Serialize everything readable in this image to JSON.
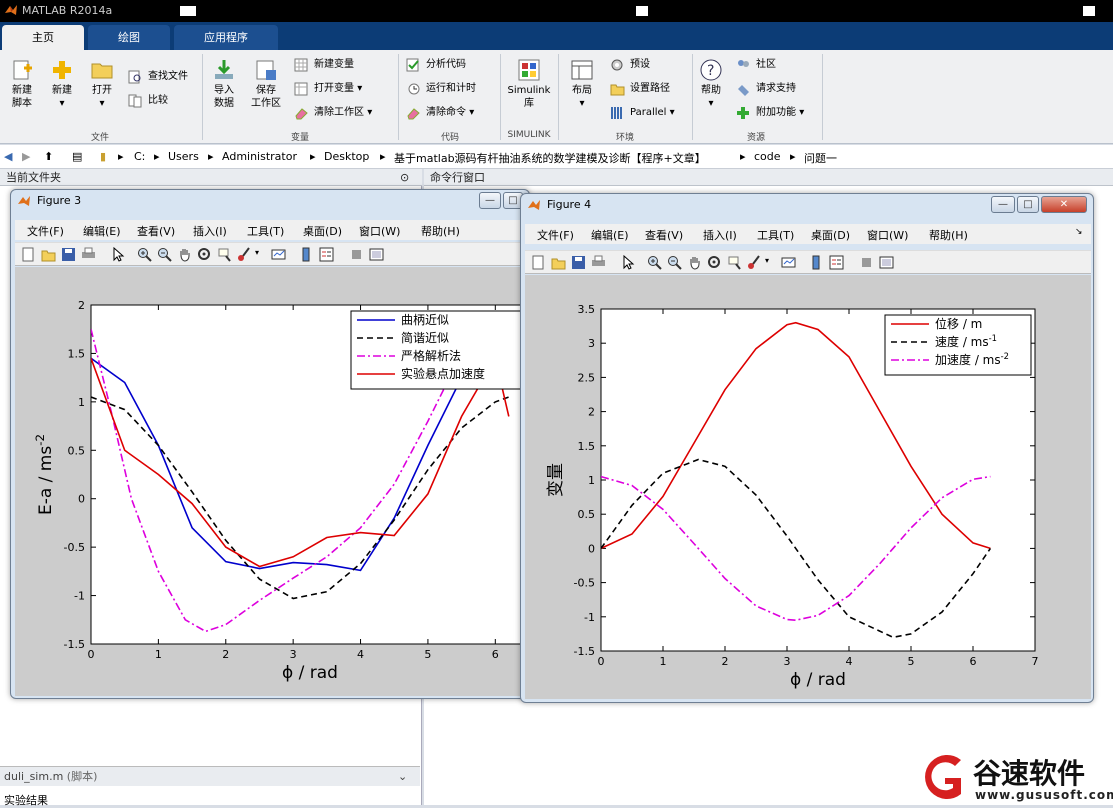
{
  "app": {
    "title": "MATLAB R2014a"
  },
  "tabs": [
    {
      "label": "主页"
    },
    {
      "label": "绘图"
    },
    {
      "label": "应用程序"
    }
  ],
  "ribbon": {
    "new_script": "新建\n脚本",
    "new": "新建",
    "open": "打开",
    "find_files": "查找文件",
    "compare": "比较",
    "import_data": "导入\n数据",
    "save_workspace": "保存\n工作区",
    "new_variable": "新建变量",
    "open_variable": "打开变量",
    "clear_workspace": "清除工作区",
    "analyze_code": "分析代码",
    "run_and_time": "运行和计时",
    "clear_commands": "清除命令",
    "simulink": "Simulink\n库",
    "layout": "布局",
    "preferences": "预设",
    "set_path": "设置路径",
    "parallel": "Parallel",
    "help": "帮助",
    "community": "社区",
    "request_support": "请求支持",
    "add_ons": "附加功能",
    "groups": {
      "file": "文件",
      "variable": "变量",
      "code": "代码",
      "simulink": "SIMULINK",
      "environment": "环境",
      "resources": "资源"
    }
  },
  "address": {
    "parts": [
      "C:",
      "Users",
      "Administrator",
      "Desktop",
      "基于matlab源码有杆抽油系统的数学建模及诊断【程序+文章】",
      "code",
      "问题一"
    ]
  },
  "panels": {
    "current_folder": "当前文件夹",
    "command_window": "命令行窗口",
    "script_file": "duli_sim.m",
    "script_type": "(脚本)",
    "bottom_text": "实验结果"
  },
  "figure3": {
    "title": "Figure 3",
    "menu": [
      "文件(F)",
      "编辑(E)",
      "查看(V)",
      "插入(I)",
      "工具(T)",
      "桌面(D)",
      "窗口(W)",
      "帮助(H)"
    ],
    "chart_data": {
      "type": "line",
      "xlabel": "ϕ / rad",
      "ylabel": "E-a / ms-2",
      "xlim": [
        0,
        6.5
      ],
      "ylim": [
        -1.5,
        2
      ],
      "xticks": [
        0,
        1,
        2,
        3,
        4,
        5,
        6
      ],
      "yticks": [
        -1.5,
        -1,
        -0.5,
        0,
        0.5,
        1,
        1.5,
        2
      ],
      "legend_position": "top-right",
      "series": [
        {
          "name": "曲柄近似",
          "color": "#0000cc",
          "dash": "solid",
          "x": [
            0,
            0.5,
            1,
            1.5,
            2,
            2.5,
            3,
            3.5,
            4,
            4.5,
            5,
            5.5,
            6,
            6.2
          ],
          "y": [
            1.45,
            1.2,
            0.55,
            -0.3,
            -0.65,
            -0.72,
            -0.66,
            -0.68,
            -0.74,
            -0.2,
            0.55,
            1.25,
            1.45,
            1.45
          ]
        },
        {
          "name": "简谐近似",
          "color": "#000000",
          "dash": "dashed",
          "x": [
            0,
            0.5,
            1,
            1.5,
            2,
            2.5,
            3,
            3.5,
            4,
            4.5,
            5,
            5.5,
            6,
            6.2
          ],
          "y": [
            1.05,
            0.92,
            0.55,
            0.07,
            -0.43,
            -0.83,
            -1.03,
            -0.96,
            -0.67,
            -0.22,
            0.3,
            0.73,
            1.0,
            1.05
          ]
        },
        {
          "name": "严格解析法",
          "color": "#dd00dd",
          "dash": "dashdot",
          "x": [
            0,
            0.3,
            0.6,
            1,
            1.4,
            1.7,
            2,
            2.5,
            3,
            3.5,
            4,
            4.5,
            5,
            5.5,
            5.8
          ],
          "y": [
            1.75,
            0.9,
            0.0,
            -0.75,
            -1.25,
            -1.37,
            -1.3,
            -1.05,
            -0.82,
            -0.6,
            -0.3,
            0.15,
            0.8,
            1.5,
            1.9
          ]
        },
        {
          "name": "实验悬点加速度",
          "color": "#dd0000",
          "dash": "solid",
          "x": [
            0,
            0.5,
            1,
            1.5,
            2,
            2.5,
            3,
            3.5,
            4,
            4.5,
            5,
            5.5,
            6,
            6.2
          ],
          "y": [
            1.45,
            0.5,
            0.25,
            -0.05,
            -0.5,
            -0.7,
            -0.6,
            -0.4,
            -0.35,
            -0.38,
            0.05,
            0.85,
            1.45,
            0.85
          ]
        }
      ]
    }
  },
  "figure4": {
    "title": "Figure 4",
    "menu": [
      "文件(F)",
      "编辑(E)",
      "查看(V)",
      "插入(I)",
      "工具(T)",
      "桌面(D)",
      "窗口(W)",
      "帮助(H)"
    ],
    "chart_data": {
      "type": "line",
      "xlabel": "ϕ / rad",
      "ylabel": "变量",
      "xlim": [
        0,
        7
      ],
      "ylim": [
        -1.5,
        3.5
      ],
      "xticks": [
        0,
        1,
        2,
        3,
        4,
        5,
        6,
        7
      ],
      "yticks": [
        -1.5,
        -1,
        -0.5,
        0,
        0.5,
        1,
        1.5,
        2,
        2.5,
        3,
        3.5
      ],
      "legend_position": "top-right",
      "series": [
        {
          "name": "位移 / m",
          "color": "#dd0000",
          "dash": "solid",
          "x": [
            0,
            0.5,
            1,
            1.5,
            2,
            2.5,
            3,
            3.14,
            3.5,
            4,
            4.5,
            5,
            5.5,
            6,
            6.28
          ],
          "y": [
            0,
            0.21,
            0.76,
            1.54,
            2.32,
            2.92,
            3.27,
            3.3,
            3.2,
            2.8,
            2.0,
            1.2,
            0.5,
            0.08,
            0
          ]
        },
        {
          "name": "速度 / ms-1",
          "color": "#000000",
          "dash": "dashed",
          "x": [
            0,
            0.5,
            1,
            1.57,
            2,
            2.5,
            3,
            3.5,
            4,
            4.71,
            5,
            5.5,
            6,
            6.28
          ],
          "y": [
            0,
            0.63,
            1.1,
            1.3,
            1.2,
            0.78,
            0.18,
            -0.46,
            -1.0,
            -1.3,
            -1.25,
            -0.93,
            -0.37,
            0
          ]
        },
        {
          "name": "加速度 / ms-2",
          "color": "#dd00dd",
          "dash": "dashdot",
          "x": [
            0,
            0.5,
            1,
            1.5,
            2,
            2.5,
            3,
            3.14,
            3.5,
            4,
            4.5,
            5,
            5.5,
            6,
            6.28
          ],
          "y": [
            1.05,
            0.92,
            0.57,
            0.07,
            -0.44,
            -0.84,
            -1.04,
            -1.05,
            -0.98,
            -0.69,
            -0.22,
            0.3,
            0.74,
            1.01,
            1.05
          ]
        }
      ]
    }
  },
  "watermark": {
    "brand": "谷速软件",
    "url": "www.gususoft.com"
  }
}
